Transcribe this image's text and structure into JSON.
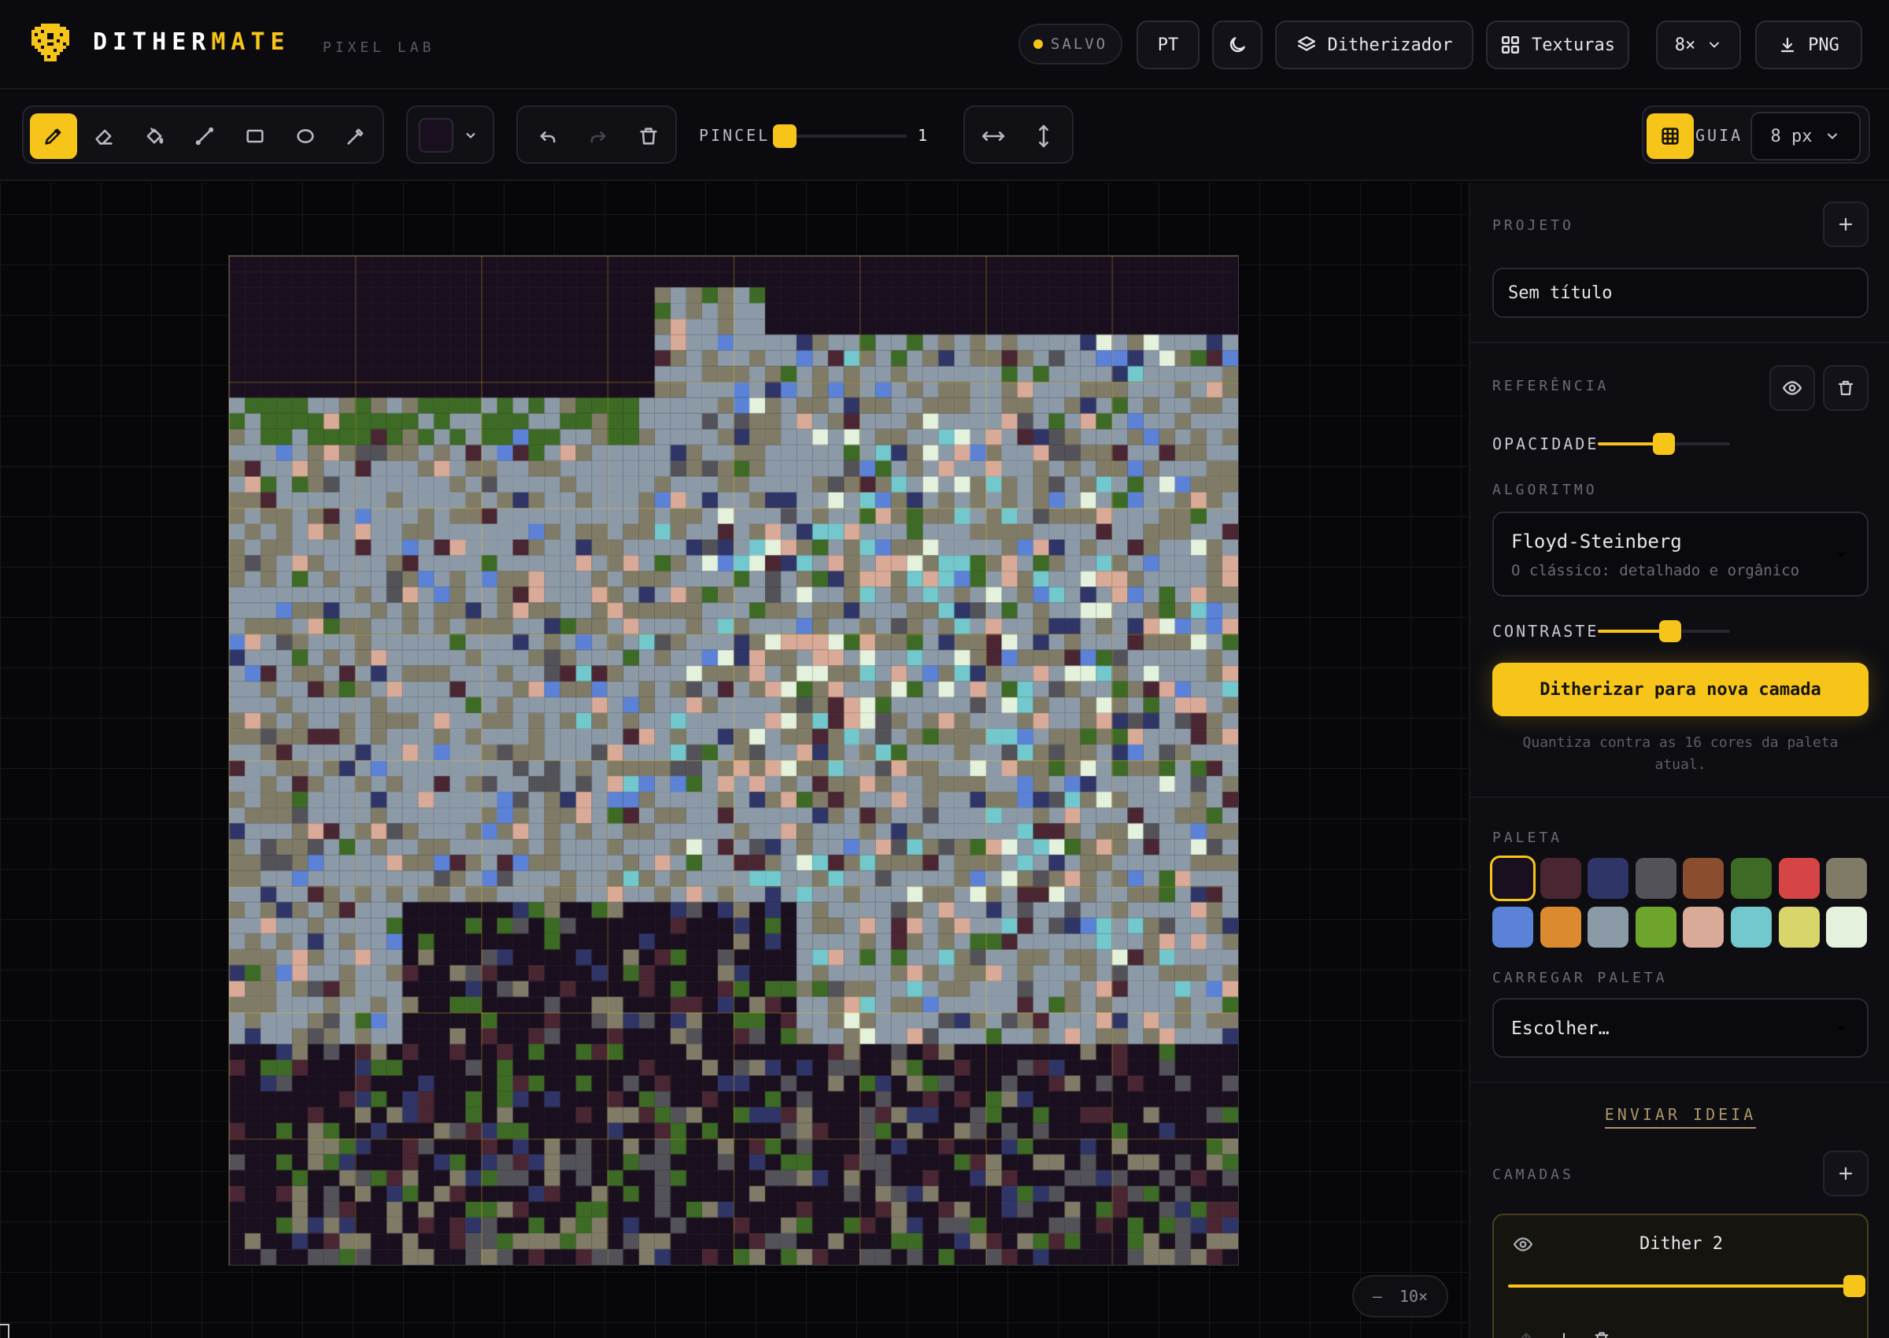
{
  "app": {
    "brand_part1": "DITHER",
    "brand_part2": "MATE",
    "subtitle": "PIXEL LAB",
    "accent_color": "#f7c51a"
  },
  "topbar": {
    "saved_label": "SALVO",
    "lang_label": "PT",
    "theme_icon": "moon-icon",
    "ditherizer_label": "Ditherizador",
    "textures_label": "Texturas",
    "scale_value": "8×",
    "export_label": "PNG"
  },
  "toolbar": {
    "tools": [
      {
        "name": "pencil",
        "icon": "pencil-icon",
        "active": true
      },
      {
        "name": "eraser",
        "icon": "eraser-icon",
        "active": false
      },
      {
        "name": "fill",
        "icon": "paint-bucket-icon",
        "active": false
      },
      {
        "name": "line",
        "icon": "line-icon",
        "active": false
      },
      {
        "name": "rectangle",
        "icon": "rectangle-icon",
        "active": false
      },
      {
        "name": "ellipse",
        "icon": "ellipse-icon",
        "active": false
      },
      {
        "name": "eyedropper",
        "icon": "eyedropper-icon",
        "active": false
      }
    ],
    "current_color": "#1a0f1e",
    "brush_label": "PINCEL",
    "brush_value": "1",
    "guide_label": "GUIA",
    "guide_size": "8 px"
  },
  "canvas": {
    "zoom_minus": "–",
    "zoom_value": "10×",
    "grid_cells": 64,
    "guide_every": 8
  },
  "panel": {
    "project_label": "PROJETO",
    "project_name": "Sem título",
    "reference_label": "REFERÊNCIA",
    "opacity_label": "OPACIDADE",
    "opacity_value": 0.5,
    "algorithm_label": "ALGORITMO",
    "algorithm_name": "Floyd-Steinberg",
    "algorithm_desc": "O clássico: detalhado e orgânico",
    "contrast_label": "CONTRASTE",
    "contrast_value": 0.55,
    "dither_button": "Ditherizar para nova camada",
    "dither_hint": "Quantiza contra as 16 cores da paleta atual.",
    "palette_label": "PALETA",
    "palette": [
      "#1a0f1e",
      "#4a2632",
      "#2f3566",
      "#525258",
      "#8a4e2e",
      "#3d6a24",
      "#d64545",
      "#7f7b66",
      "#5b82d6",
      "#dc8a30",
      "#8c9aa8",
      "#6fa42c",
      "#d9aa98",
      "#72c8cc",
      "#d8d66a",
      "#e4f1dc"
    ],
    "load_palette_label": "CARREGAR PALETA",
    "load_palette_value": "Escolher…",
    "send_idea": "ENVIAR IDEIA",
    "layers_label": "CAMADAS",
    "layers": [
      {
        "name": "Dither 2",
        "opacity": 1.0
      }
    ]
  }
}
